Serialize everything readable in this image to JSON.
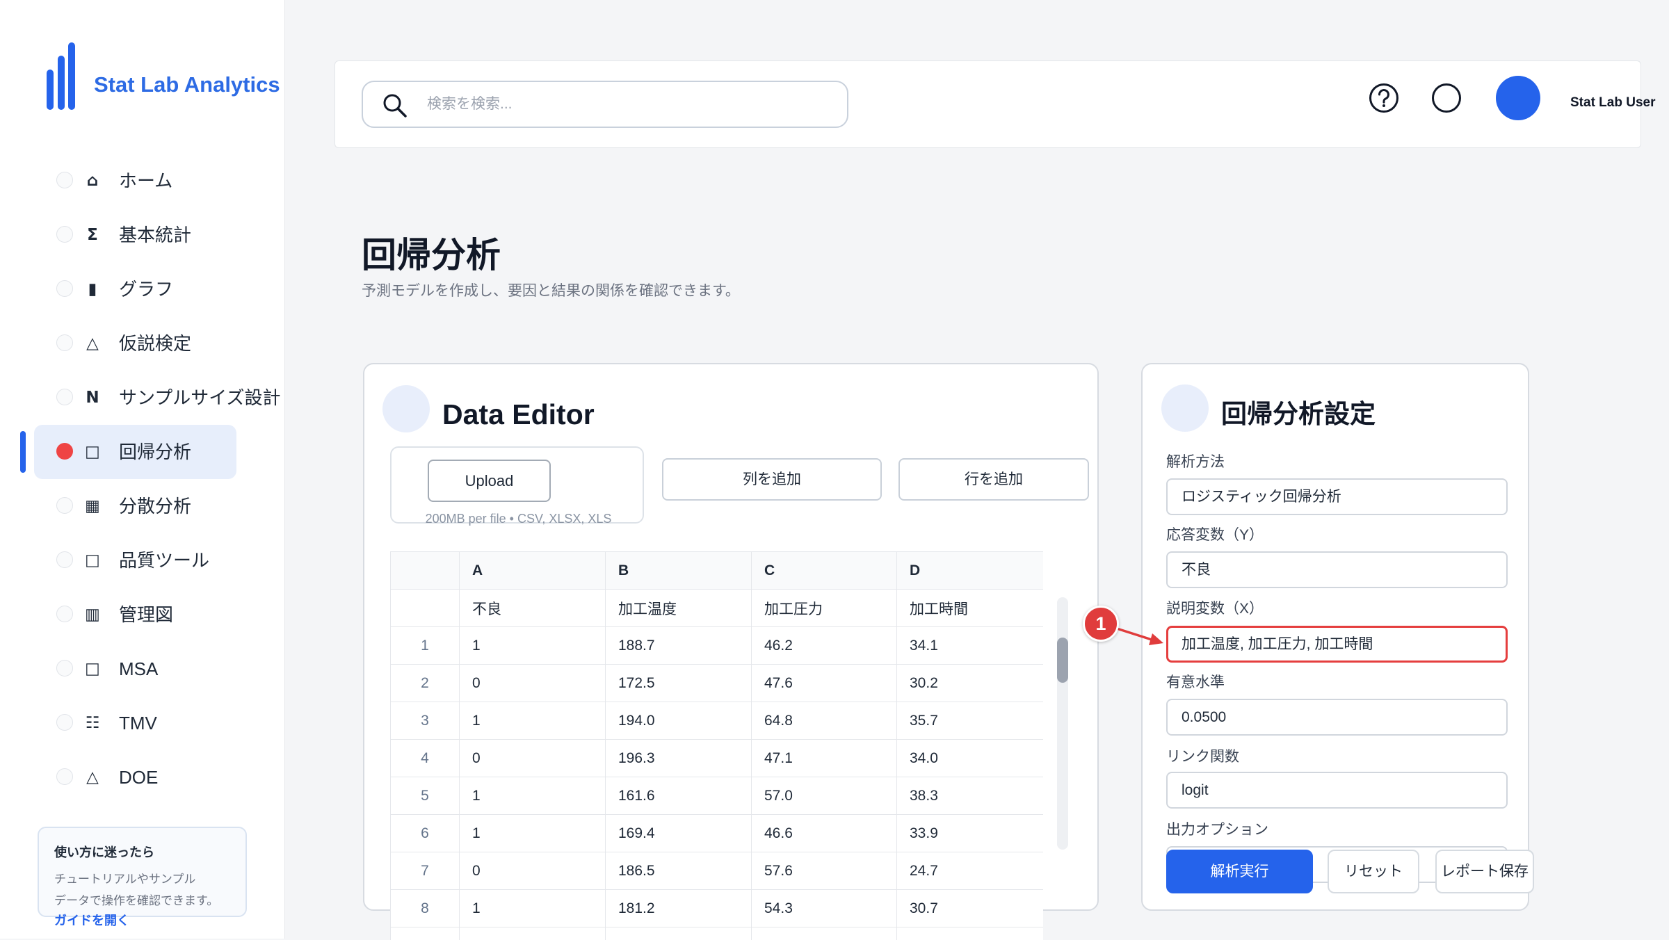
{
  "app": {
    "name": "Stat Lab Analytics"
  },
  "sidebar": {
    "items": [
      {
        "icon": "home-icon",
        "glyph": "⌂",
        "label": "ホーム",
        "active": false
      },
      {
        "icon": "sigma-icon",
        "glyph": "Σ",
        "label": "基本統計",
        "active": false
      },
      {
        "icon": "bar-chart-icon",
        "glyph": "▮",
        "label": "グラフ",
        "active": false
      },
      {
        "icon": "triangle-icon",
        "glyph": "△",
        "label": "仮説検定",
        "active": false
      },
      {
        "icon": "n-letter-icon",
        "glyph": "N",
        "label": "サンプルサイズ設計",
        "active": false
      },
      {
        "icon": "square-icon",
        "glyph": "□",
        "label": "回帰分析",
        "active": true
      },
      {
        "icon": "grid-icon",
        "glyph": "▦",
        "label": "分散分析",
        "active": false
      },
      {
        "icon": "square-icon",
        "glyph": "□",
        "label": "品質ツール",
        "active": false
      },
      {
        "icon": "columns-icon",
        "glyph": "▥",
        "label": "管理図",
        "active": false
      },
      {
        "icon": "square-icon",
        "glyph": "□",
        "label": "MSA",
        "active": false
      },
      {
        "icon": "list-icon",
        "glyph": "☷",
        "label": "TMV",
        "active": false
      },
      {
        "icon": "triangle-icon",
        "glyph": "△",
        "label": "DOE",
        "active": false
      }
    ],
    "help": {
      "title": "使い方に迷ったら",
      "body_line1": "チュートリアルやサンプル",
      "body_line2": "データで操作を確認できます。",
      "link": "ガイドを開く"
    }
  },
  "header": {
    "search_icon": "search-icon",
    "search_placeholder": "検索を検索...",
    "help_icon": "question-circle-icon",
    "circle_icon": "circle-icon",
    "avatar_icon": "user-avatar-icon",
    "user_name": "Stat Lab User"
  },
  "page": {
    "title": "回帰分析",
    "subtitle": "予測モデルを作成し、要因と結果の関係を確認できます。"
  },
  "data_editor": {
    "title": "Data Editor",
    "upload_label": "Upload",
    "upload_hint": "200MB per file • CSV, XLSX, XLS",
    "add_column_label": "列を追加",
    "add_row_label": "行を追加",
    "columns": [
      "A",
      "B",
      "C",
      "D"
    ],
    "column_names": [
      "不良",
      "加工温度",
      "加工圧力",
      "加工時間"
    ],
    "rows": [
      {
        "index": "1",
        "values": [
          "1",
          "188.7",
          "46.2",
          "34.1"
        ]
      },
      {
        "index": "2",
        "values": [
          "0",
          "172.5",
          "47.6",
          "30.2"
        ]
      },
      {
        "index": "3",
        "values": [
          "1",
          "194.0",
          "64.8",
          "35.7"
        ]
      },
      {
        "index": "4",
        "values": [
          "0",
          "196.3",
          "47.1",
          "34.0"
        ]
      },
      {
        "index": "5",
        "values": [
          "1",
          "161.6",
          "57.0",
          "38.3"
        ]
      },
      {
        "index": "6",
        "values": [
          "1",
          "169.4",
          "46.6",
          "33.9"
        ]
      },
      {
        "index": "7",
        "values": [
          "0",
          "186.5",
          "57.6",
          "24.7"
        ]
      },
      {
        "index": "8",
        "values": [
          "1",
          "181.2",
          "54.3",
          "30.7"
        ]
      }
    ]
  },
  "settings": {
    "title": "回帰分析設定",
    "fields": [
      {
        "label": "解析方法",
        "value": "ロジスティック回帰分析"
      },
      {
        "label": "応答変数（Y）",
        "value": "不良"
      },
      {
        "label": "説明変数（X）",
        "value": "加工温度, 加工圧力, 加工時間",
        "highlighted": true
      },
      {
        "label": "有意水準",
        "value": "0.0500"
      },
      {
        "label": "リンク関数",
        "value": "logit"
      },
      {
        "label": "出力オプション"
      }
    ],
    "run_label": "解析実行",
    "reset_label": "リセット",
    "save_label": "レポート保存"
  },
  "annotation": {
    "label": "1"
  },
  "colors": {
    "accent": "#2563eb",
    "active_dot": "#ef4444",
    "annotation": "#e03c3c",
    "highlight_border": "#e53e3e"
  }
}
